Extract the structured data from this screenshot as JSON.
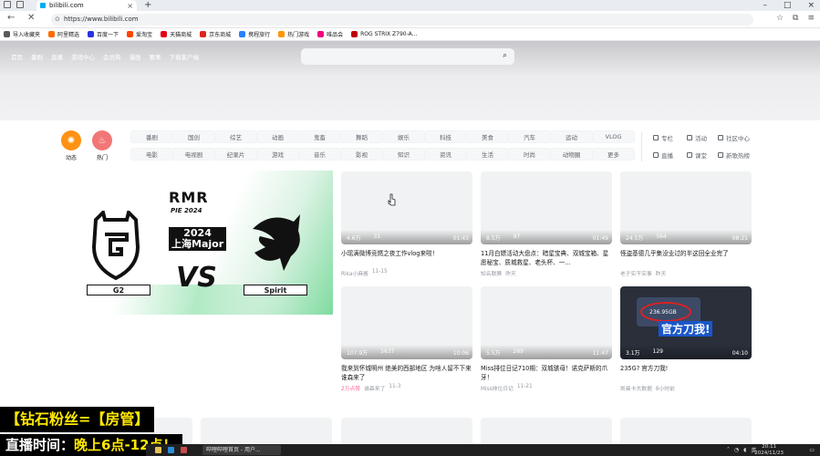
{
  "browser": {
    "tab_title": "bilibili.com",
    "url": "https://www.bilibili.com",
    "bookmarks": [
      {
        "label": "导入收藏夹",
        "color": "#5a5a5a"
      },
      {
        "label": "阿里精选",
        "color": "#ff6a00"
      },
      {
        "label": "百度一下",
        "color": "#2932e1"
      },
      {
        "label": "爱淘宝",
        "color": "#ff4400"
      },
      {
        "label": "天猫商城",
        "color": "#e60012"
      },
      {
        "label": "京东商城",
        "color": "#e1251b"
      },
      {
        "label": "携程旅行",
        "color": "#2681ff"
      },
      {
        "label": "热门游戏",
        "color": "#ff9500"
      },
      {
        "label": "唯品会",
        "color": "#f10180"
      },
      {
        "label": "ROG STRIX Z790-A...",
        "color": "#c00000"
      }
    ]
  },
  "topnav": {
    "items": [
      "首页",
      "番剧",
      "直播",
      "游戏中心",
      "会员购",
      "漫画",
      "赛事",
      "下载客户端"
    ]
  },
  "channels": {
    "dynamic_label": "动态",
    "hot_label": "热门",
    "row1": [
      "番剧",
      "国创",
      "综艺",
      "动画",
      "鬼畜",
      "舞蹈",
      "娱乐",
      "科技",
      "美食",
      "汽车",
      "运动",
      "VLOG"
    ],
    "row2": [
      "电影",
      "电视剧",
      "纪录片",
      "游戏",
      "音乐",
      "影视",
      "知识",
      "资讯",
      "生活",
      "时尚",
      "动物圈",
      "更多"
    ],
    "side_row1": [
      "专栏",
      "活动",
      "社区中心"
    ],
    "side_row2": [
      "直播",
      "课堂",
      "新歌热榜"
    ]
  },
  "carousel": {
    "rmr": "RMR",
    "rmr_sub": "PIE 2024",
    "major_line1": "2024",
    "major_line2": "上海Major",
    "vs": "VS",
    "team_left": "G2",
    "team_right": "Spirit"
  },
  "videos": [
    {
      "views": "4.6万",
      "danmaku": "31",
      "duration": "01:43",
      "title": "小瑶满微博竞燃之夜工作vlog来啦！",
      "author": "Rika小麻酱",
      "date": "11-15"
    },
    {
      "views": "8.5万",
      "danmaku": "97",
      "duration": "01:49",
      "title": "11月白嫖活动大盘点：暗星宝典、双城宝箱、星愿秘宝、质城救星、老头杯、一...",
      "author": "知名联赛",
      "date": "昨天"
    },
    {
      "views": "24.5万",
      "danmaku": "564",
      "duration": "08:21",
      "title": "怪盗基德几乎集没业过的半这回全业完了",
      "author": "老子实干实事",
      "date": "昨天"
    },
    {
      "views": "107.9万",
      "danmaku": "5637",
      "duration": "10:06",
      "title": "我来到怀城明州 绝美的西部地区 为啥人留不下来 谁森来了",
      "tag": "2万点赞",
      "author": "谁森来了",
      "date": "11-3"
    },
    {
      "views": "5.5万",
      "danmaku": "269",
      "duration": "11:47",
      "title": "Miss排位日记710期：双城骇母！诺克萨斯的爪牙！",
      "author": "Miss排位日记",
      "date": "11-21"
    },
    {
      "views": "3.1万",
      "danmaku": "129",
      "duration": "04:10",
      "title": "235G? 官方刀我!",
      "author": "凯曼卡大数据",
      "date": "8小时前",
      "screen_text": "236.95GB",
      "caption": "官方刀我!"
    }
  ],
  "overlay": {
    "line1": "【钻石粉丝=【房管】",
    "line2_a": "直播时间：",
    "line2_b": "晚上6点-12点！"
  },
  "taskbar": {
    "window_title": "哔哩哔哩首页 - 用户...",
    "lang": "英",
    "time": "20:11",
    "date": "2024/11/23"
  }
}
